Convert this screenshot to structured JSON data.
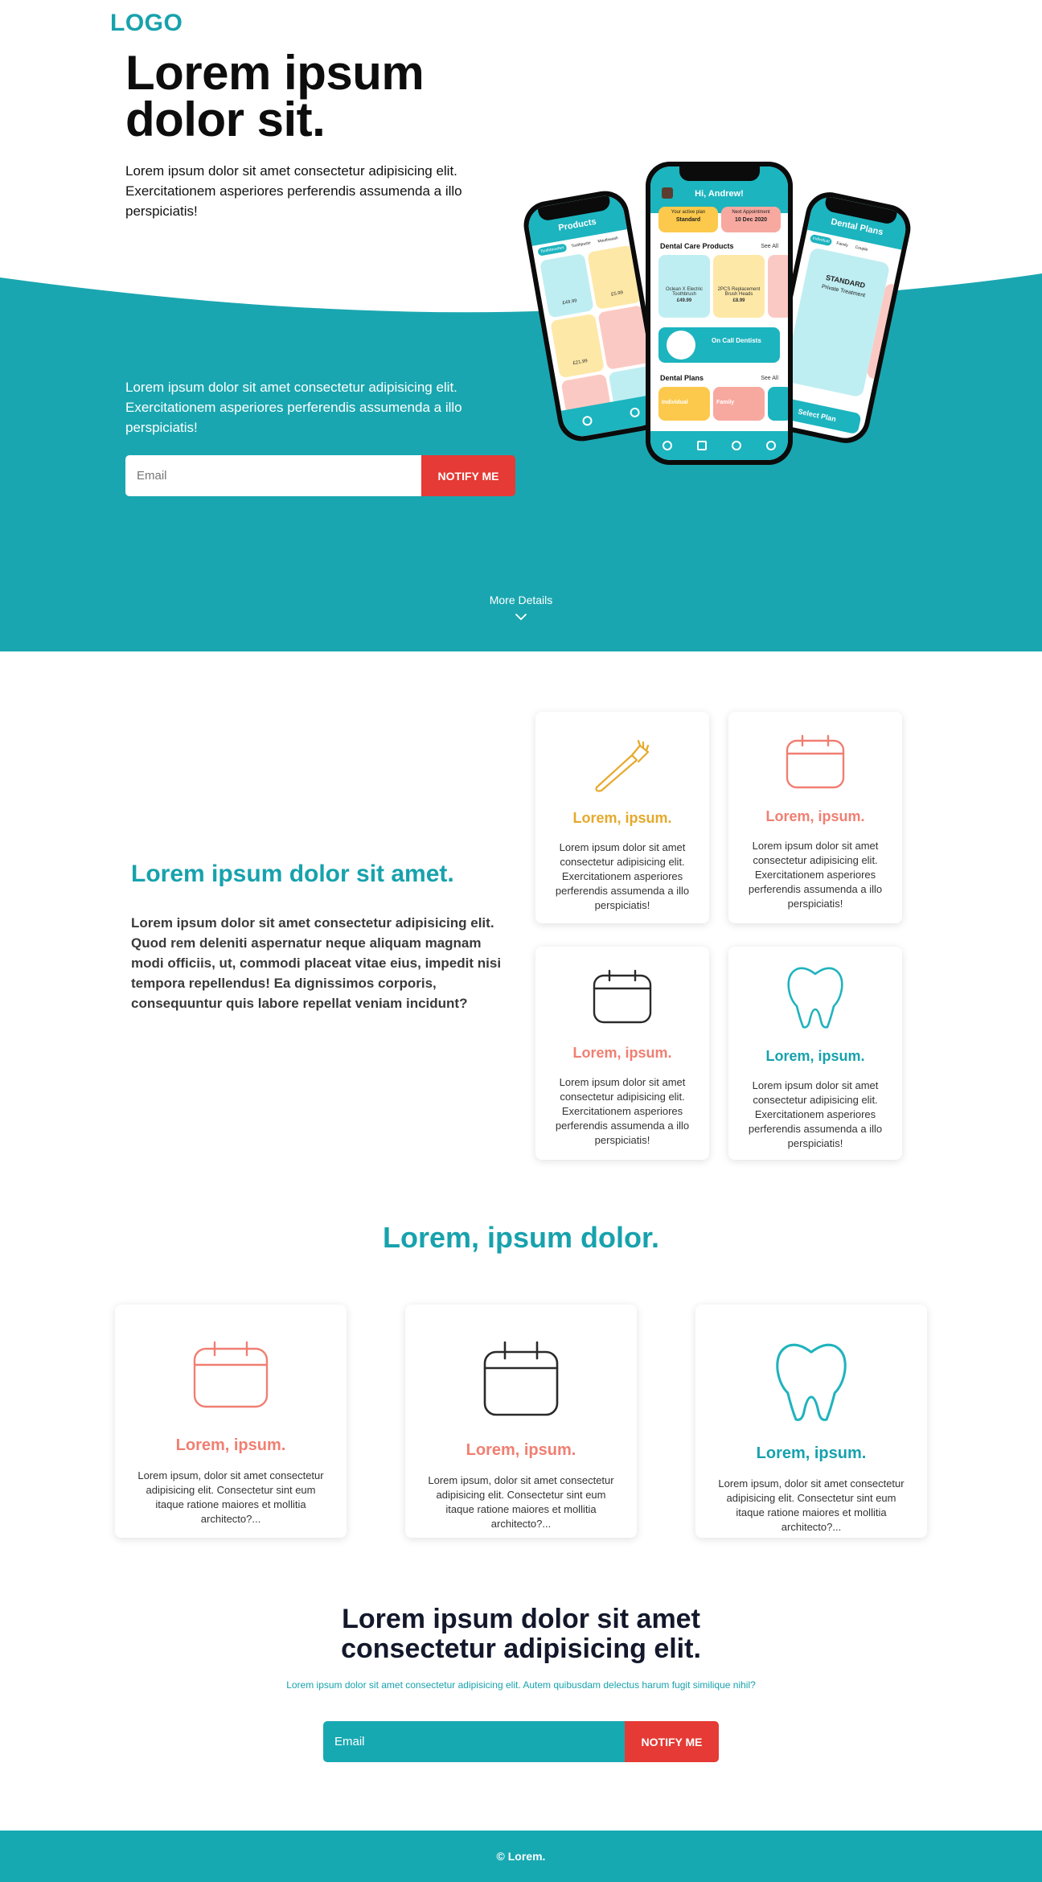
{
  "colors": {
    "brand": "#17a2ad",
    "accent_red": "#e53a35",
    "orange": "#e6a92c",
    "salmon": "#f07f72",
    "dark": "#2a2a2a"
  },
  "header": {
    "logo": "LOGO"
  },
  "hero": {
    "title": "Lorem ipsum dolor sit.",
    "text": "Lorem ipsum dolor sit amet consectetur adipisicing elit. Exercitationem asperiores perferendis assumenda a illo perspiciatis!",
    "text2": "Lorem ipsum dolor sit amet consectetur adipisicing elit. Exercitationem asperiores perferendis assumenda a illo perspiciatis!",
    "email_placeholder": "Email",
    "notify_label": "NOTIFY ME",
    "more_details": "More Details"
  },
  "phones": {
    "left": {
      "title": "Products",
      "tabs": [
        "Toothbrushes",
        "Toothpaste",
        "Mouthwash"
      ],
      "prices": [
        "£49.99",
        "£5.99",
        "£21.99"
      ]
    },
    "center": {
      "greeting": "Hi, Andrew!",
      "plan_label": "Your active plan",
      "plan_value": "Standard",
      "appt_label": "Next Appointment",
      "appt_value": "10 Dec 2020",
      "dental_products": "Dental Care Products",
      "see_all": "See All",
      "prod1": "Oclean X Electric Toothbrush",
      "prod1_price": "£49.99",
      "prod2": "2PCS Replacement Brush Heads",
      "prod2_price": "£8.99",
      "on_call": "On Call Dentists",
      "dental_plans": "Dental Plans",
      "plan1": "Individual",
      "plan2": "Family"
    },
    "right": {
      "title": "Dental Plans",
      "tabs": [
        "Individual",
        "Family",
        "Couple"
      ],
      "plan": "STANDARD",
      "plan_sub": "Private Treatment",
      "cta": "Select Plan"
    }
  },
  "features": {
    "title": "Lorem ipsum dolor sit amet.",
    "text": "Lorem ipsum dolor sit amet consectetur adipisicing elit. Quod rem deleniti aspernatur neque aliquam magnam modi officiis, ut, commodi placeat vitae eius, impedit nisi tempora repellendus! Ea dignissimos corporis, consequuntur quis labore repellat veniam incidunt?",
    "cards": [
      {
        "icon": "toothbrush-icon",
        "title": "Lorem, ipsum.",
        "text": "Lorem ipsum dolor sit amet consectetur adipisicing elit. Exercitationem asperiores perferendis assumenda a illo perspiciatis!"
      },
      {
        "icon": "calendar-icon",
        "title": "Lorem, ipsum.",
        "text": "Lorem ipsum dolor sit amet consectetur adipisicing elit. Exercitationem asperiores perferendis assumenda a illo perspiciatis!"
      },
      {
        "icon": "calendar-icon",
        "title": "Lorem, ipsum.",
        "text": "Lorem ipsum dolor sit amet consectetur adipisicing elit. Exercitationem asperiores perferendis assumenda a illo perspiciatis!"
      },
      {
        "icon": "tooth-icon",
        "title": "Lorem, ipsum.",
        "text": "Lorem ipsum dolor sit amet consectetur adipisicing elit. Exercitationem asperiores perferendis assumenda a illo perspiciatis!"
      }
    ]
  },
  "section2": {
    "title": "Lorem, ipsum dolor.",
    "cards": [
      {
        "icon": "calendar-icon",
        "title": "Lorem, ipsum.",
        "text": "Lorem ipsum, dolor sit amet consectetur adipisicing elit. Consectetur sint eum itaque ratione maiores et mollitia architecto?..."
      },
      {
        "icon": "calendar-icon",
        "title": "Lorem, ipsum.",
        "text": "Lorem ipsum, dolor sit amet consectetur adipisicing elit. Consectetur sint eum itaque ratione maiores et mollitia architecto?..."
      },
      {
        "icon": "tooth-icon",
        "title": "Lorem, ipsum.",
        "text": "Lorem ipsum, dolor sit amet consectetur adipisicing elit. Consectetur sint eum itaque ratione maiores et mollitia architecto?..."
      }
    ]
  },
  "cta": {
    "title": "Lorem ipsum dolor sit amet consectetur adipisicing elit.",
    "subtitle": "Lorem ipsum dolor sit amet consectetur adipisicing elit. Autem quibusdam delectus harum fugit similique nihil?",
    "email_placeholder": "Email",
    "notify_label": "NOTIFY ME"
  },
  "footer": {
    "copyright": "© Lorem."
  }
}
